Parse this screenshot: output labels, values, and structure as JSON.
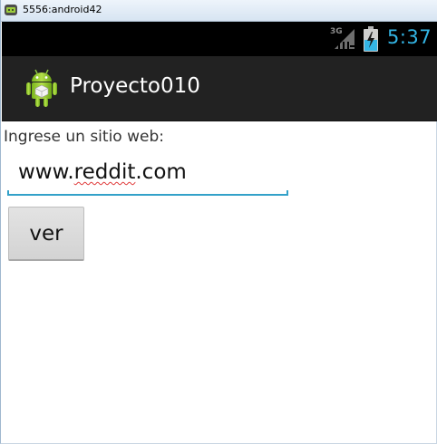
{
  "window": {
    "title": "5556:android42",
    "icon": "android-emulator-icon"
  },
  "status_bar": {
    "network_type": "3G",
    "signal_icon": "signal-icon",
    "battery_icon": "battery-charging-icon",
    "time": "5:37",
    "accent_color": "#33b5e5"
  },
  "action_bar": {
    "app_icon": "android-robot-icon",
    "title": "Proyecto010",
    "background_color": "#222222"
  },
  "main": {
    "prompt_label": "Ingrese un sitio web:",
    "url_input": {
      "value_prefix": "www.",
      "value_misspelled": "reddit",
      "value_suffix": ".com",
      "underline_color": "#33a1c9"
    },
    "button_label": "ver"
  }
}
